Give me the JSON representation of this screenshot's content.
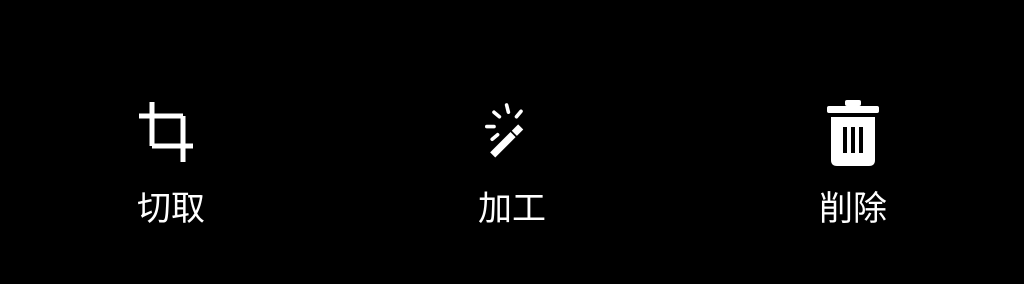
{
  "toolbar": {
    "background": "#000000",
    "icon_color": "#ffffff",
    "items": [
      {
        "icon": "crop-icon",
        "label": "切取"
      },
      {
        "icon": "magic-wand-icon",
        "label": "加工"
      },
      {
        "icon": "trash-icon",
        "label": "削除"
      }
    ]
  }
}
